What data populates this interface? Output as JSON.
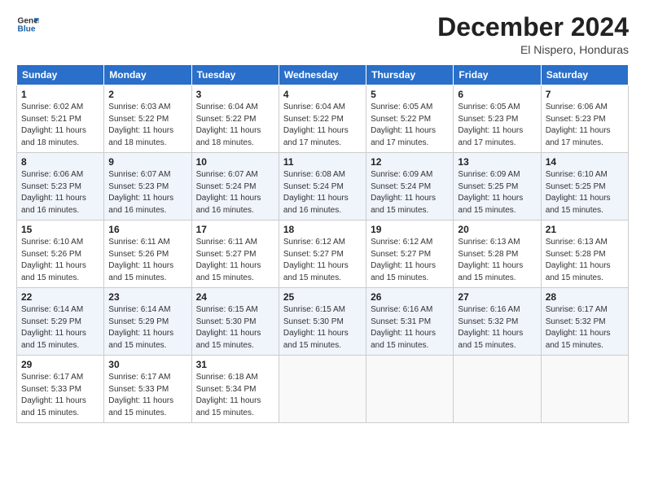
{
  "logo": {
    "line1": "General",
    "line2": "Blue"
  },
  "title": "December 2024",
  "subtitle": "El Nispero, Honduras",
  "header_days": [
    "Sunday",
    "Monday",
    "Tuesday",
    "Wednesday",
    "Thursday",
    "Friday",
    "Saturday"
  ],
  "weeks": [
    [
      {
        "day": "1",
        "info": "Sunrise: 6:02 AM\nSunset: 5:21 PM\nDaylight: 11 hours\nand 18 minutes."
      },
      {
        "day": "2",
        "info": "Sunrise: 6:03 AM\nSunset: 5:22 PM\nDaylight: 11 hours\nand 18 minutes."
      },
      {
        "day": "3",
        "info": "Sunrise: 6:04 AM\nSunset: 5:22 PM\nDaylight: 11 hours\nand 18 minutes."
      },
      {
        "day": "4",
        "info": "Sunrise: 6:04 AM\nSunset: 5:22 PM\nDaylight: 11 hours\nand 17 minutes."
      },
      {
        "day": "5",
        "info": "Sunrise: 6:05 AM\nSunset: 5:22 PM\nDaylight: 11 hours\nand 17 minutes."
      },
      {
        "day": "6",
        "info": "Sunrise: 6:05 AM\nSunset: 5:23 PM\nDaylight: 11 hours\nand 17 minutes."
      },
      {
        "day": "7",
        "info": "Sunrise: 6:06 AM\nSunset: 5:23 PM\nDaylight: 11 hours\nand 17 minutes."
      }
    ],
    [
      {
        "day": "8",
        "info": "Sunrise: 6:06 AM\nSunset: 5:23 PM\nDaylight: 11 hours\nand 16 minutes."
      },
      {
        "day": "9",
        "info": "Sunrise: 6:07 AM\nSunset: 5:23 PM\nDaylight: 11 hours\nand 16 minutes."
      },
      {
        "day": "10",
        "info": "Sunrise: 6:07 AM\nSunset: 5:24 PM\nDaylight: 11 hours\nand 16 minutes."
      },
      {
        "day": "11",
        "info": "Sunrise: 6:08 AM\nSunset: 5:24 PM\nDaylight: 11 hours\nand 16 minutes."
      },
      {
        "day": "12",
        "info": "Sunrise: 6:09 AM\nSunset: 5:24 PM\nDaylight: 11 hours\nand 15 minutes."
      },
      {
        "day": "13",
        "info": "Sunrise: 6:09 AM\nSunset: 5:25 PM\nDaylight: 11 hours\nand 15 minutes."
      },
      {
        "day": "14",
        "info": "Sunrise: 6:10 AM\nSunset: 5:25 PM\nDaylight: 11 hours\nand 15 minutes."
      }
    ],
    [
      {
        "day": "15",
        "info": "Sunrise: 6:10 AM\nSunset: 5:26 PM\nDaylight: 11 hours\nand 15 minutes."
      },
      {
        "day": "16",
        "info": "Sunrise: 6:11 AM\nSunset: 5:26 PM\nDaylight: 11 hours\nand 15 minutes."
      },
      {
        "day": "17",
        "info": "Sunrise: 6:11 AM\nSunset: 5:27 PM\nDaylight: 11 hours\nand 15 minutes."
      },
      {
        "day": "18",
        "info": "Sunrise: 6:12 AM\nSunset: 5:27 PM\nDaylight: 11 hours\nand 15 minutes."
      },
      {
        "day": "19",
        "info": "Sunrise: 6:12 AM\nSunset: 5:27 PM\nDaylight: 11 hours\nand 15 minutes."
      },
      {
        "day": "20",
        "info": "Sunrise: 6:13 AM\nSunset: 5:28 PM\nDaylight: 11 hours\nand 15 minutes."
      },
      {
        "day": "21",
        "info": "Sunrise: 6:13 AM\nSunset: 5:28 PM\nDaylight: 11 hours\nand 15 minutes."
      }
    ],
    [
      {
        "day": "22",
        "info": "Sunrise: 6:14 AM\nSunset: 5:29 PM\nDaylight: 11 hours\nand 15 minutes."
      },
      {
        "day": "23",
        "info": "Sunrise: 6:14 AM\nSunset: 5:29 PM\nDaylight: 11 hours\nand 15 minutes."
      },
      {
        "day": "24",
        "info": "Sunrise: 6:15 AM\nSunset: 5:30 PM\nDaylight: 11 hours\nand 15 minutes."
      },
      {
        "day": "25",
        "info": "Sunrise: 6:15 AM\nSunset: 5:30 PM\nDaylight: 11 hours\nand 15 minutes."
      },
      {
        "day": "26",
        "info": "Sunrise: 6:16 AM\nSunset: 5:31 PM\nDaylight: 11 hours\nand 15 minutes."
      },
      {
        "day": "27",
        "info": "Sunrise: 6:16 AM\nSunset: 5:32 PM\nDaylight: 11 hours\nand 15 minutes."
      },
      {
        "day": "28",
        "info": "Sunrise: 6:17 AM\nSunset: 5:32 PM\nDaylight: 11 hours\nand 15 minutes."
      }
    ],
    [
      {
        "day": "29",
        "info": "Sunrise: 6:17 AM\nSunset: 5:33 PM\nDaylight: 11 hours\nand 15 minutes."
      },
      {
        "day": "30",
        "info": "Sunrise: 6:17 AM\nSunset: 5:33 PM\nDaylight: 11 hours\nand 15 minutes."
      },
      {
        "day": "31",
        "info": "Sunrise: 6:18 AM\nSunset: 5:34 PM\nDaylight: 11 hours\nand 15 minutes."
      },
      {
        "day": "",
        "info": ""
      },
      {
        "day": "",
        "info": ""
      },
      {
        "day": "",
        "info": ""
      },
      {
        "day": "",
        "info": ""
      }
    ]
  ]
}
